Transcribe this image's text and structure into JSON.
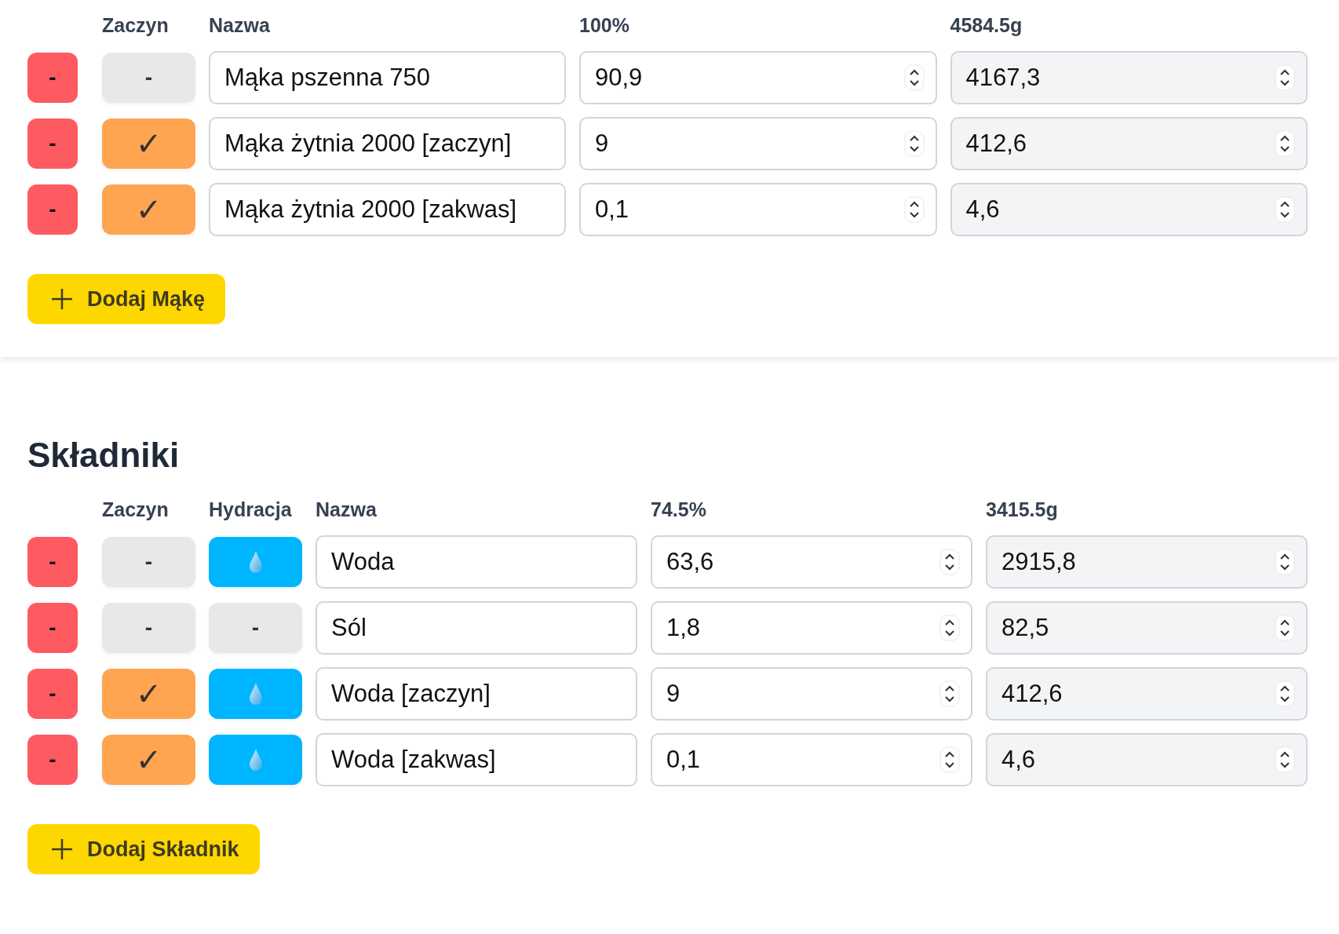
{
  "flours": {
    "columns": {
      "starter": "Zaczyn",
      "name": "Nazwa",
      "percent": "100%",
      "grams": "4584.5g"
    },
    "rows": [
      {
        "remove": "-",
        "starter": false,
        "starter_mark": "-",
        "name": "Mąka pszenna 750",
        "percent": "90,9",
        "grams": "4167,3"
      },
      {
        "remove": "-",
        "starter": true,
        "starter_mark": "✓",
        "name": "Mąka żytnia 2000 [zaczyn]",
        "percent": "9",
        "grams": "412,6"
      },
      {
        "remove": "-",
        "starter": true,
        "starter_mark": "✓",
        "name": "Mąka żytnia 2000 [zakwas]",
        "percent": "0,1",
        "grams": "4,6"
      }
    ],
    "add_button": "Dodaj Mąkę"
  },
  "ingredients": {
    "title": "Składniki",
    "columns": {
      "starter": "Zaczyn",
      "hydration": "Hydracja",
      "name": "Nazwa",
      "percent": "74.5%",
      "grams": "3415.5g"
    },
    "rows": [
      {
        "remove": "-",
        "starter": false,
        "starter_mark": "-",
        "hydration": true,
        "name": "Woda",
        "percent": "63,6",
        "grams": "2915,8"
      },
      {
        "remove": "-",
        "starter": false,
        "starter_mark": "-",
        "hydration": false,
        "hydration_mark": "-",
        "name": "Sól",
        "percent": "1,8",
        "grams": "82,5"
      },
      {
        "remove": "-",
        "starter": true,
        "starter_mark": "✓",
        "hydration": true,
        "name": "Woda [zaczyn]",
        "percent": "9",
        "grams": "412,6"
      },
      {
        "remove": "-",
        "starter": true,
        "starter_mark": "✓",
        "hydration": true,
        "name": "Woda [zakwas]",
        "percent": "0,1",
        "grams": "4,6"
      }
    ],
    "add_button": "Dodaj Składnik"
  }
}
